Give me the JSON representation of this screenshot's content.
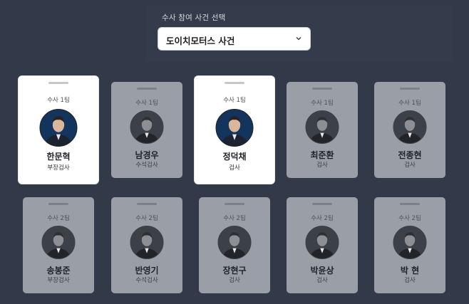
{
  "selector": {
    "label": "수사 참여 사건 선택",
    "value": "도이치모터스 사건"
  },
  "prosecutors": [
    {
      "team": "수사 1팀",
      "name": "한문혁",
      "role": "부장검사",
      "active": true
    },
    {
      "team": "수사 1팀",
      "name": "남경우",
      "role": "수석검사",
      "active": false
    },
    {
      "team": "수사 1팀",
      "name": "정덕채",
      "role": "검사",
      "active": true
    },
    {
      "team": "수사 1팀",
      "name": "최준환",
      "role": "검사",
      "active": false
    },
    {
      "team": "수사 1팀",
      "name": "전종현",
      "role": "검사",
      "active": false
    },
    {
      "team": "수사 2팀",
      "name": "송봉준",
      "role": "부장검사",
      "active": false
    },
    {
      "team": "수사 2팀",
      "name": "반영기",
      "role": "수석검사",
      "active": false
    },
    {
      "team": "수사 2팀",
      "name": "장현구",
      "role": "검사",
      "active": false
    },
    {
      "team": "수사 2팀",
      "name": "박윤상",
      "role": "검사",
      "active": false
    },
    {
      "team": "수사 2팀",
      "name": "박 현",
      "role": "검사",
      "active": false
    }
  ]
}
